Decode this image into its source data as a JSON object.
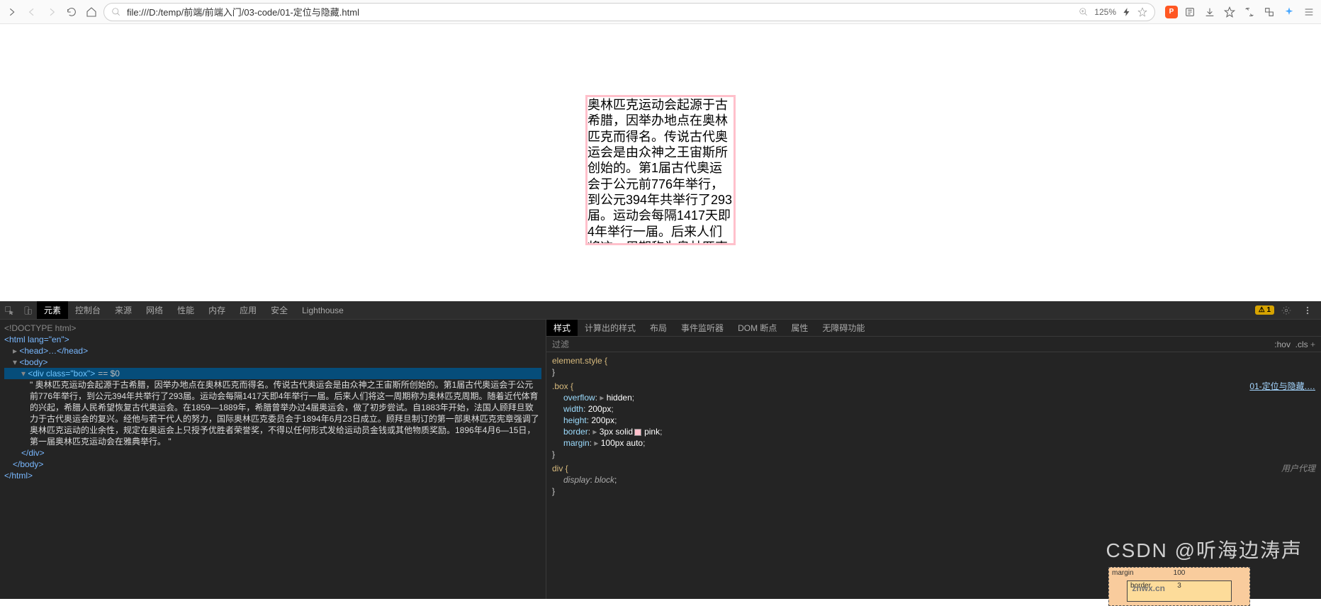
{
  "toolbar": {
    "url": "file:///D:/temp/前端/前端入门/03-code/01-定位与隐藏.html",
    "zoom": "125%"
  },
  "page": {
    "box_text": "奥林匹克运动会起源于古希腊，因举办地点在奥林匹克而得名。传说古代奥运会是由众神之王宙斯所创始的。第1届古代奥运会于公元前776年举行，到公元394年共举行了293届。运动会每隔1417天即4年举行一届。后来人们将这一周期称为奥林匹克周期。随着近代体育"
  },
  "devtools": {
    "tabs": [
      "元素",
      "控制台",
      "来源",
      "网络",
      "性能",
      "内存",
      "应用",
      "安全",
      "Lighthouse"
    ],
    "active_tab": "元素",
    "warn_count": "1",
    "dom": {
      "doctype": "<!DOCTYPE html>",
      "html_open": "<html lang=\"en\">",
      "head": "<head>…</head>",
      "body_open": "<body>",
      "sel_div": "<div class=\"box\">",
      "sel_eq": "== $0",
      "text": "\" 奥林匹克运动会起源于古希腊，因举办地点在奥林匹克而得名。传说古代奥运会是由众神之王宙斯所创始的。第1届古代奥运会于公元前776年举行，到公元394年共举行了293届。运动会每隔1417天即4年举行一届。后来人们将这一周期称为奥林匹克周期。随着近代体育的兴起，希腊人民希望恢复古代奥运会。在1859—1889年，希腊曾举办过4届奥运会，做了初步尝试。自1883年开始，法国人顾拜旦致力于古代奥运会的复兴。经他与若干代人的努力，国际奥林匹克委员会于1894年6月23日成立。顾拜旦制订的第一部奥林匹克宪章强调了奥林匹克运动的业余性，规定在奥运会上只授予优胜者荣誉奖，不得以任何形式发给运动员金钱或其他物质奖励。1896年4月6—15日，第一届奥林匹克运动会在雅典举行。 \"",
      "div_close": "</div>",
      "body_close": "</body>",
      "html_close": "</html>"
    },
    "styles": {
      "tabs": [
        "样式",
        "计算出的样式",
        "布局",
        "事件监听器",
        "DOM 断点",
        "属性",
        "无障碍功能"
      ],
      "active": "样式",
      "filter": "过滤",
      "hov": ":hov",
      "cls": ".cls",
      "src_link": "01-定位与隐藏.…",
      "element_style": "element.style {",
      "box_sel": ".box {",
      "r1a": "overflow",
      "r1b": "hidden",
      "r2a": "width",
      "r2b": "200px",
      "r3a": "height",
      "r3b": "200px",
      "r4a": "border",
      "r4b": "3px solid",
      "r4c": "pink",
      "r5a": "margin",
      "r5b": "100px auto",
      "div_sel": "div {",
      "r6a": "display",
      "r6b": "block",
      "ua": "用户代理",
      "close_brace": "}"
    },
    "boxmodel": {
      "margin": "margin",
      "m_top": "100",
      "border": "border",
      "b_top": "3"
    }
  },
  "watermark": "CSDN @听海边涛声",
  "watermark2": "znwx.cn"
}
